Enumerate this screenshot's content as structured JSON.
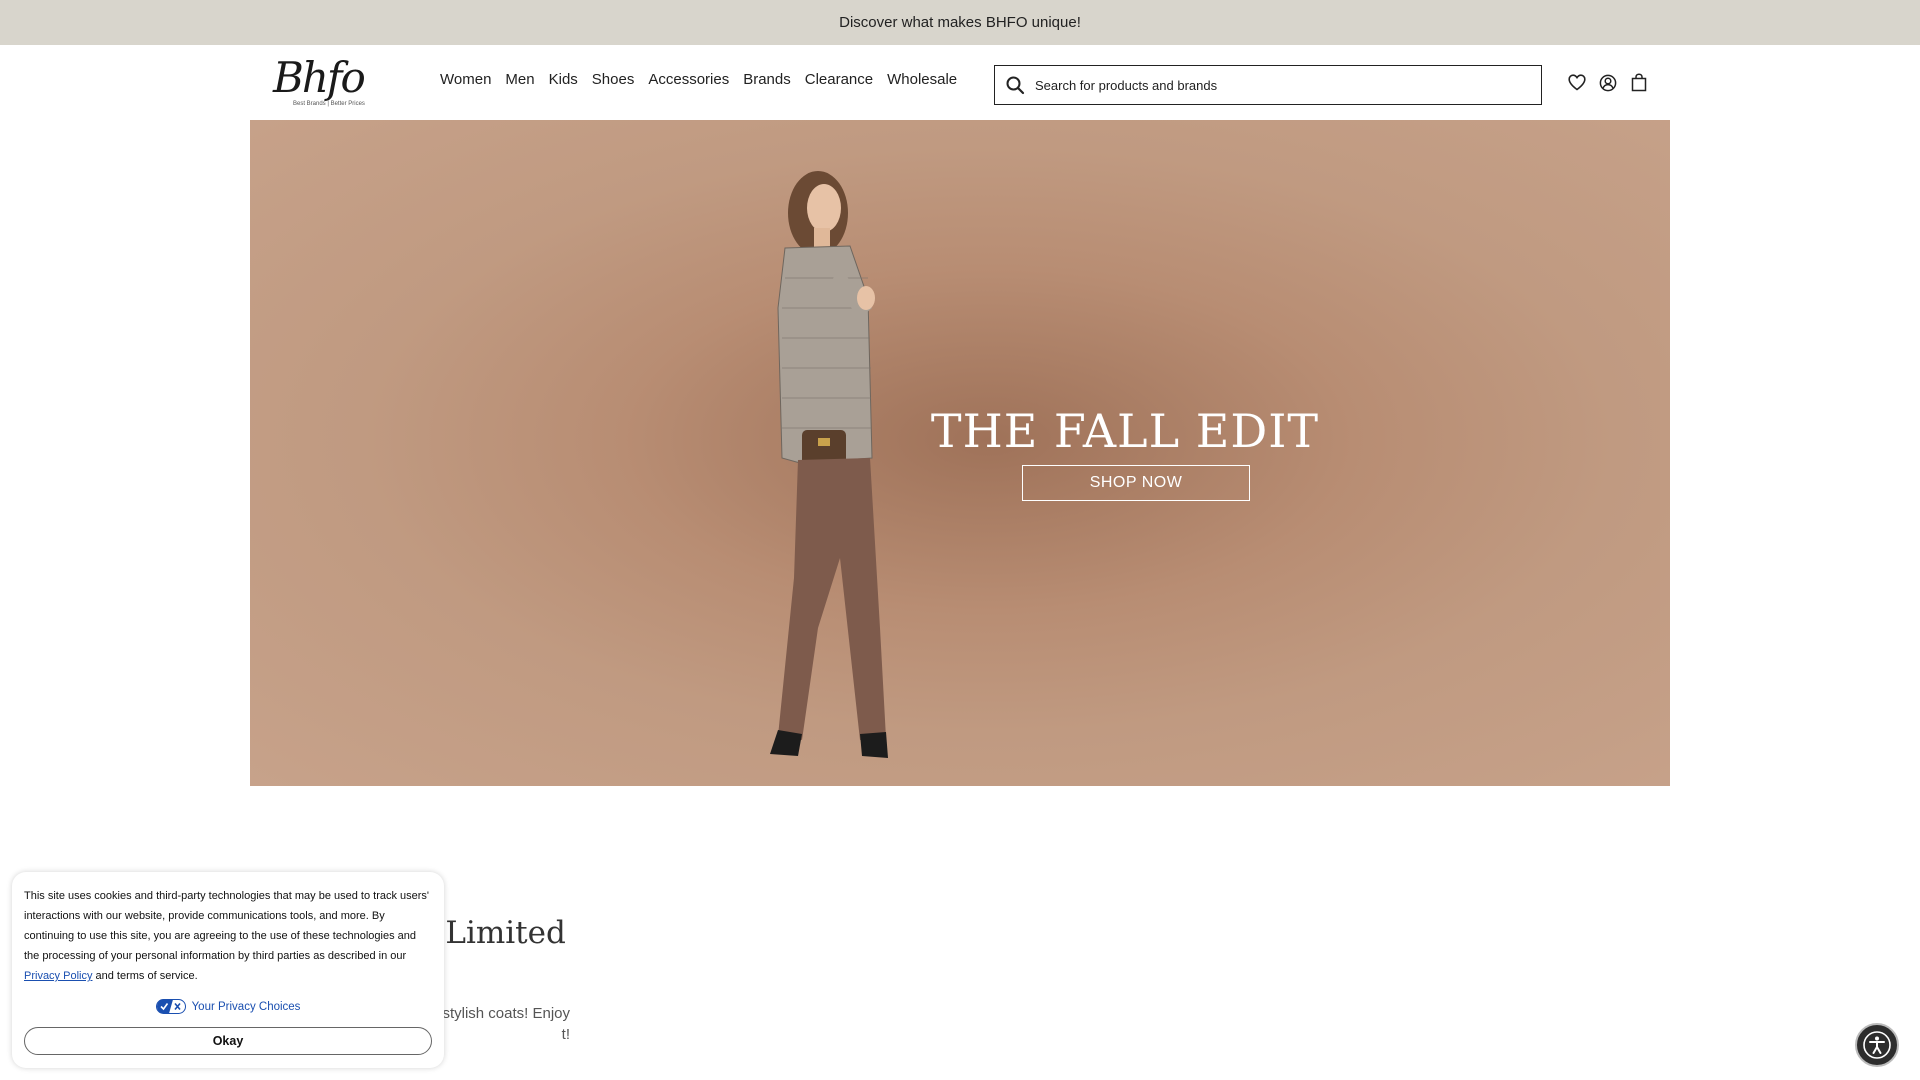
{
  "promo_bar": {
    "text": "Discover what makes BHFO unique!"
  },
  "header": {
    "logo_text": "Bhfo",
    "logo_tagline": "Best Brands  |  Better Prices",
    "nav": [
      "Women",
      "Men",
      "Kids",
      "Shoes",
      "Accessories",
      "Brands",
      "Clearance",
      "Wholesale"
    ],
    "search_placeholder": "Search for products and brands",
    "icons": [
      "heart-icon",
      "account-icon",
      "bag-icon"
    ]
  },
  "hero": {
    "title": "THE FALL EDIT",
    "button_label": "SHOP NOW"
  },
  "promo_section": {
    "title_partial": "– Limited",
    "body_partial_line1": "r stylish coats! Enjoy",
    "body_partial_line2": "t!"
  },
  "cookie_banner": {
    "text_before_link": "This site uses cookies and third-party technologies that may be used to track users' interactions with our website, provide communications tools, and more. By continuing to use this site, you are agreeing to the use of these technologies and the processing of your personal information by third parties as described in our ",
    "link_text": "Privacy Policy",
    "text_after_link": " and terms of service.",
    "privacy_choices_label": "Your Privacy Choices",
    "okay_label": "Okay"
  },
  "colors": {
    "promo_bar_bg": "#d8d5cc",
    "hero_bg": "#c09a81",
    "link": "#1a4fb0"
  }
}
